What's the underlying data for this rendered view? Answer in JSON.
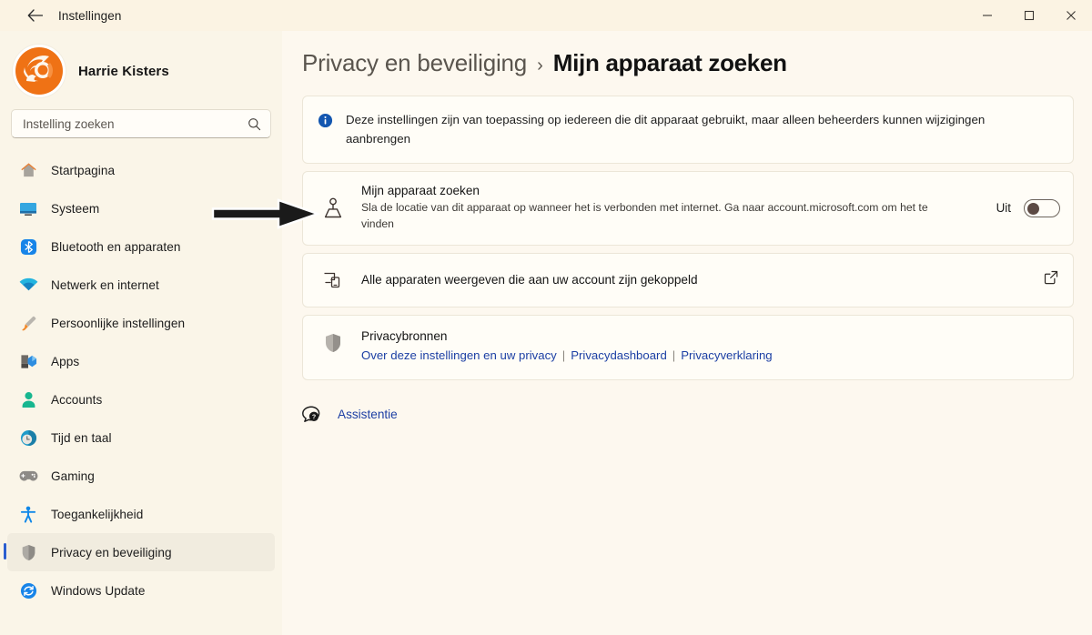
{
  "window": {
    "title": "Instellingen",
    "back_label": "back-arrow",
    "controls": {
      "minimize": "–",
      "maximize": "□",
      "close": "×"
    }
  },
  "sidebar": {
    "profile": {
      "name": "Harrie Kisters",
      "avatar_icon": "user-avatar-logo"
    },
    "search": {
      "placeholder": "Instelling zoeken",
      "value": "",
      "icon": "search-icon"
    },
    "items": [
      {
        "label": "Startpagina",
        "icon": "home-icon",
        "active": false
      },
      {
        "label": "Systeem",
        "icon": "monitor-icon",
        "active": false
      },
      {
        "label": "Bluetooth en apparaten",
        "icon": "bluetooth-icon",
        "active": false
      },
      {
        "label": "Netwerk en internet",
        "icon": "wifi-icon",
        "active": false
      },
      {
        "label": "Persoonlijke instellingen",
        "icon": "paintbrush-icon",
        "active": false
      },
      {
        "label": "Apps",
        "icon": "apps-icon",
        "active": false
      },
      {
        "label": "Accounts",
        "icon": "person-icon",
        "active": false
      },
      {
        "label": "Tijd en taal",
        "icon": "clock-globe-icon",
        "active": false
      },
      {
        "label": "Gaming",
        "icon": "gamepad-icon",
        "active": false
      },
      {
        "label": "Toegankelijkheid",
        "icon": "accessibility-icon",
        "active": false
      },
      {
        "label": "Privacy en beveiliging",
        "icon": "shield-icon",
        "active": true
      },
      {
        "label": "Windows Update",
        "icon": "update-refresh-icon",
        "active": false
      }
    ]
  },
  "main": {
    "breadcrumb": {
      "parent": "Privacy en beveiliging",
      "separator": "›",
      "current": "Mijn apparaat zoeken"
    },
    "banner": {
      "icon": "info-icon",
      "text": "Deze instellingen zijn van toepassing op iedereen die dit apparaat gebruikt, maar alleen beheerders kunnen wijzigingen aanbrengen"
    },
    "find_device": {
      "icon": "location-person-icon",
      "title": "Mijn apparaat zoeken",
      "description": "Sla de locatie van dit apparaat op wanneer het is verbonden met internet. Ga naar account.microsoft.com om het te vinden",
      "toggle_state_label": "Uit",
      "toggle_on": false
    },
    "devices_link": {
      "icon": "devices-icon",
      "label": "Alle apparaten weergeven die aan uw account zijn gekoppeld",
      "external_icon": "external-link-icon"
    },
    "privacy_resources": {
      "icon": "shield-grey-icon",
      "title": "Privacybronnen",
      "links": [
        "Over deze instellingen en uw privacy",
        "Privacydashboard",
        "Privacyverklaring"
      ],
      "link_separator": "|"
    },
    "assistance": {
      "icon": "help-bubble-icon",
      "label": "Assistentie"
    }
  },
  "annotation": {
    "arrow": "black-arrow-pointing-right"
  },
  "colors": {
    "page_background": "#fdf8ef",
    "sidebar_background": "#faf5e8",
    "card_background": "#fffdf7",
    "accent_blue": "#1c3fa4",
    "selection_indicator": "#2b5ed0",
    "brand_orange": "#ef7215"
  }
}
